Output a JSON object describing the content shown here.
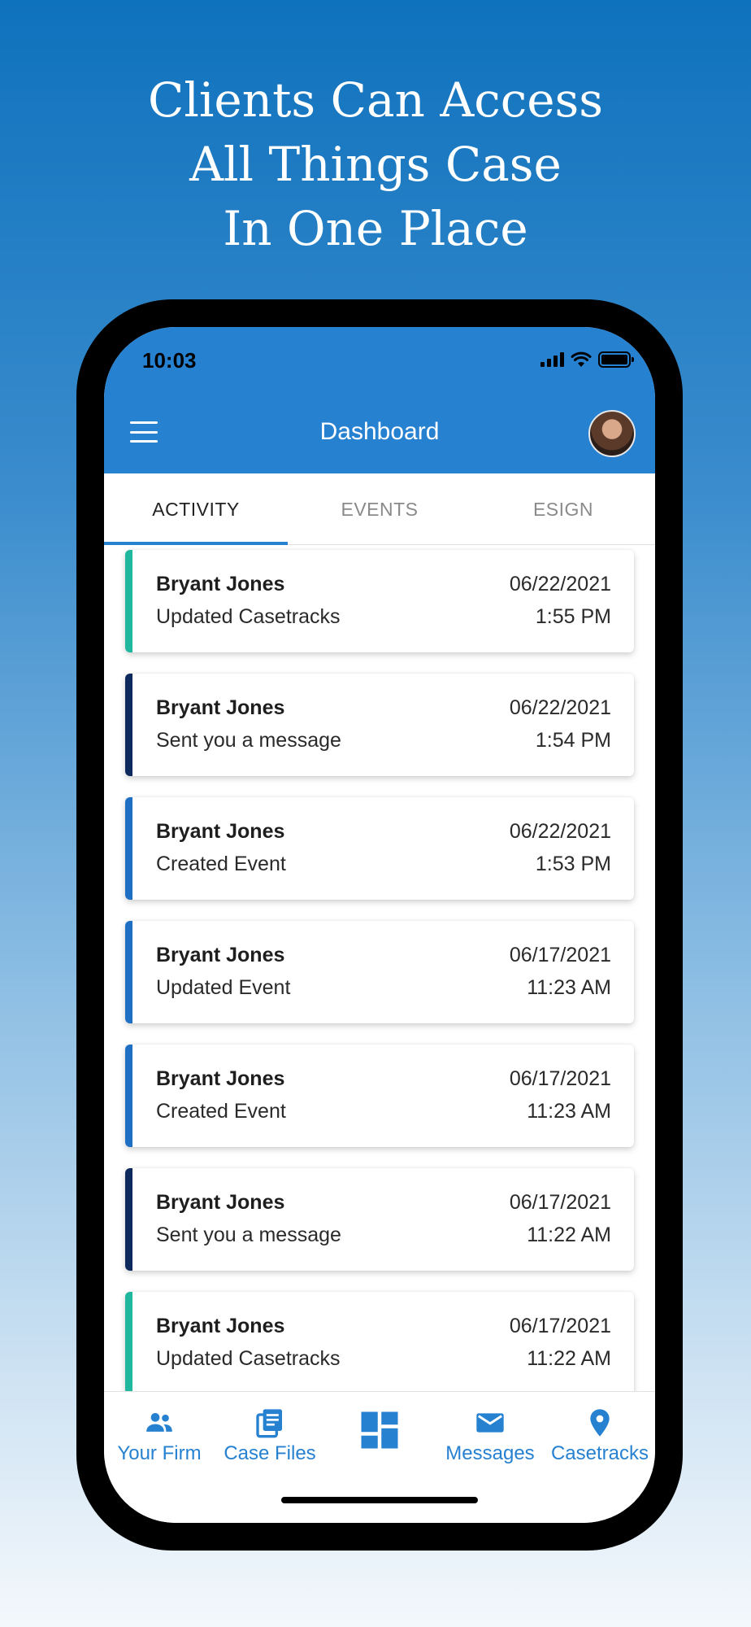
{
  "headline": [
    "Clients Can Access",
    "All Things Case",
    "In One Place"
  ],
  "status_bar": {
    "time": "10:03"
  },
  "app_bar": {
    "title": "Dashboard"
  },
  "tabs": [
    {
      "label": "ACTIVITY",
      "active": true
    },
    {
      "label": "EVENTS",
      "active": false
    },
    {
      "label": "ESIGN",
      "active": false
    }
  ],
  "colors": {
    "primary": "#2681d1",
    "teal": "#1fb89e",
    "navy": "#0e2a5c",
    "blue": "#1f6fc4"
  },
  "activity": [
    {
      "name": "Bryant Jones",
      "action": "Updated Casetracks",
      "date": "06/22/2021",
      "time": "1:55 PM",
      "accent": "teal"
    },
    {
      "name": "Bryant Jones",
      "action": "Sent you a message",
      "date": "06/22/2021",
      "time": "1:54 PM",
      "accent": "navy"
    },
    {
      "name": "Bryant Jones",
      "action": "Created Event",
      "date": "06/22/2021",
      "time": "1:53 PM",
      "accent": "blue"
    },
    {
      "name": "Bryant Jones",
      "action": "Updated Event",
      "date": "06/17/2021",
      "time": "11:23 AM",
      "accent": "blue"
    },
    {
      "name": "Bryant Jones",
      "action": "Created Event",
      "date": "06/17/2021",
      "time": "11:23 AM",
      "accent": "blue"
    },
    {
      "name": "Bryant Jones",
      "action": "Sent you a message",
      "date": "06/17/2021",
      "time": "11:22 AM",
      "accent": "navy"
    },
    {
      "name": "Bryant Jones",
      "action": "Updated Casetracks",
      "date": "06/17/2021",
      "time": "11:22 AM",
      "accent": "teal"
    }
  ],
  "bottom_nav": [
    {
      "label": "Your Firm",
      "icon": "people-icon"
    },
    {
      "label": "Case Files",
      "icon": "document-stack-icon"
    },
    {
      "label": "",
      "icon": "dashboard-grid-icon"
    },
    {
      "label": "Messages",
      "icon": "envelope-icon"
    },
    {
      "label": "Casetracks",
      "icon": "map-pin-icon"
    }
  ]
}
